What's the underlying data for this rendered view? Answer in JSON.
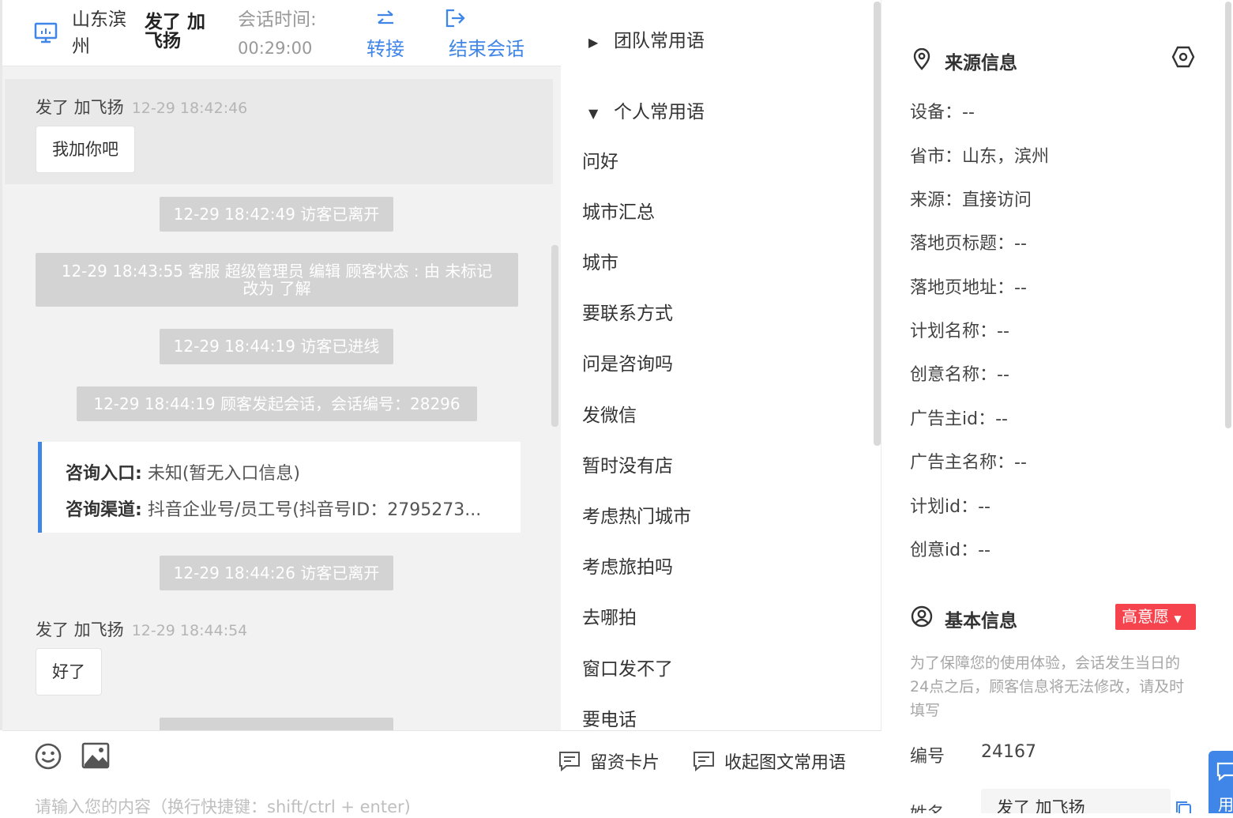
{
  "header": {
    "location": "山东滨州",
    "visitor_name": "发了 加飞扬",
    "session_time_label": "会话时间:",
    "session_time": "00:29:00",
    "transfer_label": "转接",
    "end_label": "结束会话"
  },
  "chat": {
    "messages": [
      {
        "sender": "发了 加飞扬",
        "time": "12-29 18:42:46",
        "text": "我加你吧"
      },
      {
        "sender": "发了 加飞扬",
        "time": "12-29 18:44:54",
        "text": "好了"
      }
    ],
    "system": [
      "12-29 18:42:49 访客已离开",
      "12-29 18:43:55 客服 超级管理员 编辑 顾客状态 : 由 未标记 改为 了解",
      "12-29 18:44:19 访客已进线",
      "12-29 18:44:19 顾客发起会话，会话编号：28296",
      "12-29 18:44:26 访客已离开"
    ],
    "info_card": {
      "entry_label": "咨询入口:",
      "entry_value": "未知(暂无入口信息)",
      "channel_label": "咨询渠道:",
      "channel_value": "抖音企业号/员工号(抖音号ID：2795273..."
    }
  },
  "phrases": {
    "team_group": "团队常用语",
    "personal_group": "个人常用语",
    "items": [
      "问好",
      "城市汇总",
      "城市",
      "要联系方式",
      "问是咨询吗",
      "发微信",
      "暂时没有店",
      "考虑热门城市",
      "考虑旅拍吗",
      "去哪拍",
      "窗口发不了",
      "要电话"
    ]
  },
  "input": {
    "card_btn": "留资卡片",
    "collapse_btn": "收起图文常用语",
    "placeholder": "请输入您的内容（换行快捷键：shift/ctrl + enter)"
  },
  "source": {
    "title": "来源信息",
    "fields": [
      "设备：--",
      "省市：山东，滨州",
      "来源：直接访问",
      "落地页标题：--",
      "落地页地址：--",
      "计划名称：--",
      "创意名称：--",
      "广告主id：--",
      "广告主名称：--",
      "计划id：--",
      "创意id：--"
    ]
  },
  "basic": {
    "title": "基本信息",
    "intent_tag": "高意愿",
    "note": "为了保障您的使用体验，会话发生当日的24点之后，顾客信息将无法修改，请及时填写",
    "id_label": "编号",
    "id_value": "24167",
    "name_label": "姓名",
    "name_value": "发了 加飞扬"
  },
  "float_btn": "用",
  "colors": {
    "accent": "#3f86e8",
    "tag": "#f5444e",
    "system_msg": "#d3d3d3"
  }
}
